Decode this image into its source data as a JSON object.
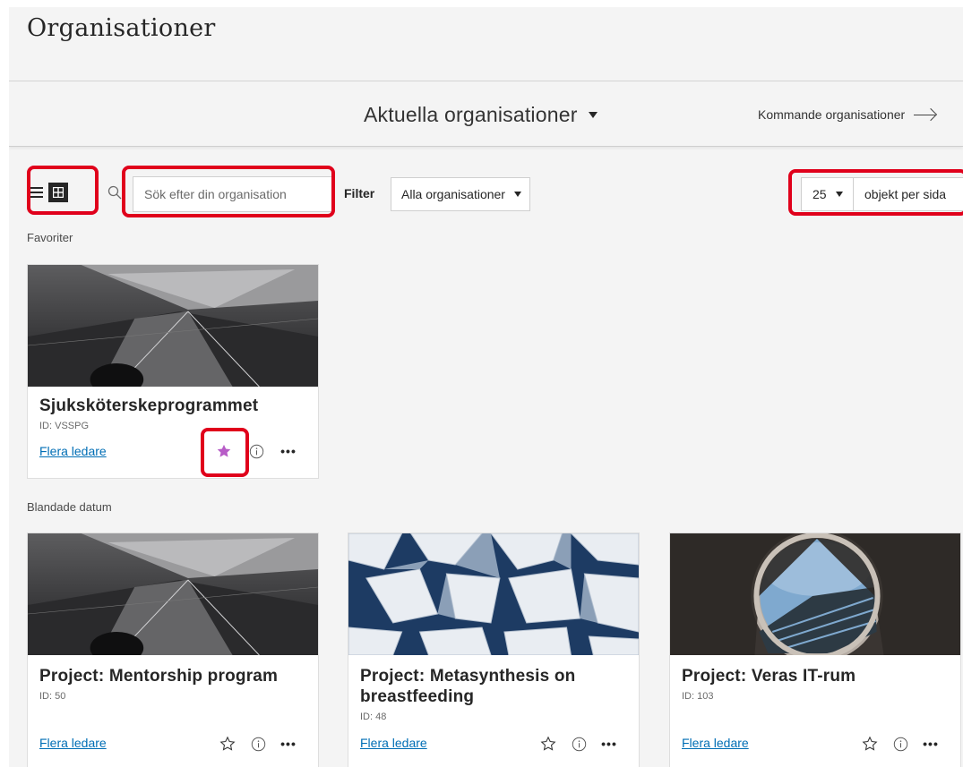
{
  "page": {
    "title": "Organisationer"
  },
  "subnav": {
    "current_label": "Aktuella organisationer",
    "next_label": "Kommande organisationer"
  },
  "toolbar": {
    "search_placeholder": "Sök efter din organisation",
    "filter_label": "Filter",
    "filter_value": "Alla organisationer",
    "per_page_value": "25",
    "per_page_label": "objekt per sida"
  },
  "sections": {
    "favorites": "Favoriter",
    "mixed_dates": "Blandade datum"
  },
  "cards": [
    {
      "title": "Sjuksköterskeprogrammet",
      "id": "ID: VSSPG",
      "link": "Flera ledare",
      "favorite": true
    },
    {
      "title": "Project: Mentorship program",
      "id": "ID: 50",
      "link": "Flera ledare",
      "favorite": false
    },
    {
      "title_line1": "Project: Metasynthesis on",
      "title_line2": "breastfeeding",
      "id": "ID: 48",
      "link": "Flera ledare",
      "favorite": false
    },
    {
      "title": "Project: Veras IT-rum",
      "id": "ID: 103",
      "link": "Flera ledare",
      "favorite": false
    }
  ],
  "colors": {
    "highlight": "#e0001b",
    "favorite_star": "#b75cc7",
    "link": "#006eb5"
  }
}
